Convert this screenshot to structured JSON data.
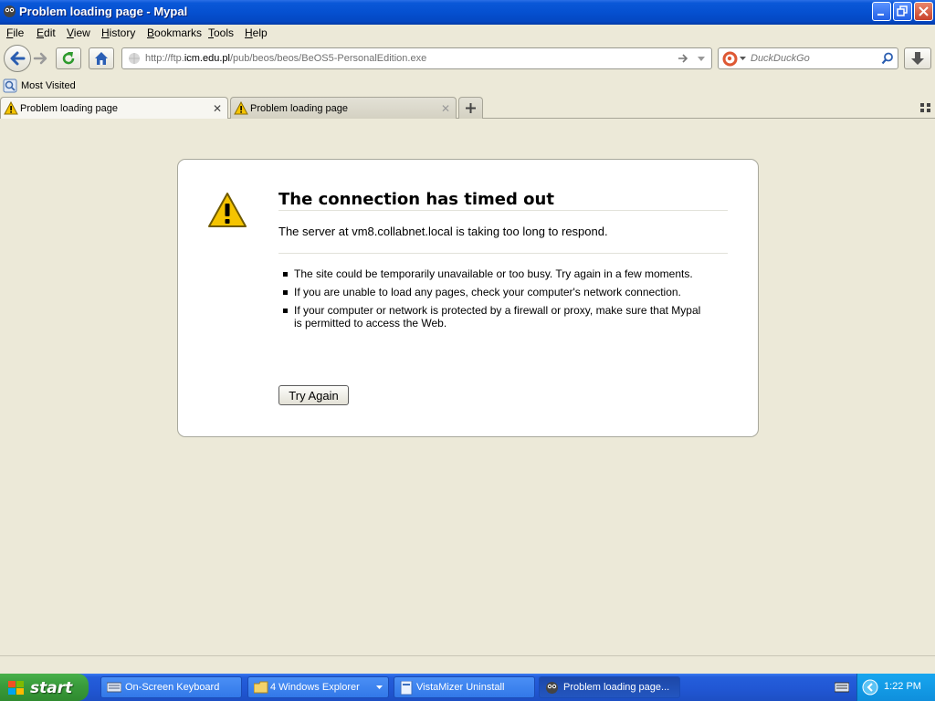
{
  "window": {
    "title": "Problem loading page - Mypal"
  },
  "menu": {
    "items": [
      "File",
      "Edit",
      "View",
      "History",
      "Bookmarks",
      "Tools",
      "Help"
    ]
  },
  "navbar": {
    "url_prefix": "http://ftp.",
    "url_domain": "icm.edu.pl",
    "url_path": "/pub/beos/beos/BeOS5-PersonalEdition.exe",
    "search_placeholder": "DuckDuckGo"
  },
  "bookmarks": {
    "most_visited": "Most Visited"
  },
  "tabs": [
    {
      "label": "Problem loading page",
      "active": true
    },
    {
      "label": "Problem loading page",
      "active": false
    }
  ],
  "error": {
    "title": "The connection has timed out",
    "description": "The server at vm8.collabnet.local is taking too long to respond.",
    "bullets": [
      "The site could be temporarily unavailable or too busy. Try again in a few moments.",
      "If you are unable to load any pages, check your computer's network connection.",
      "If your computer or network is protected by a firewall or proxy, make sure that Mypal is permitted to access the Web."
    ],
    "try_again_label": "Try Again"
  },
  "taskbar": {
    "start_label": "start",
    "items": [
      {
        "label": "On-Screen Keyboard",
        "icon": "keyboard-icon"
      },
      {
        "label": "4 Windows Explorer",
        "icon": "folder-icon"
      },
      {
        "label": "VistaMizer Uninstall",
        "icon": "document-icon"
      },
      {
        "label": "Problem loading page...",
        "icon": "mypal-icon"
      }
    ],
    "clock": "1:22 PM"
  },
  "colors": {
    "titlebar": "#0550d0",
    "taskbar": "#245edb",
    "start": "#3a9d3c",
    "tray": "#0f8fdc",
    "warning": "#f5c400"
  }
}
